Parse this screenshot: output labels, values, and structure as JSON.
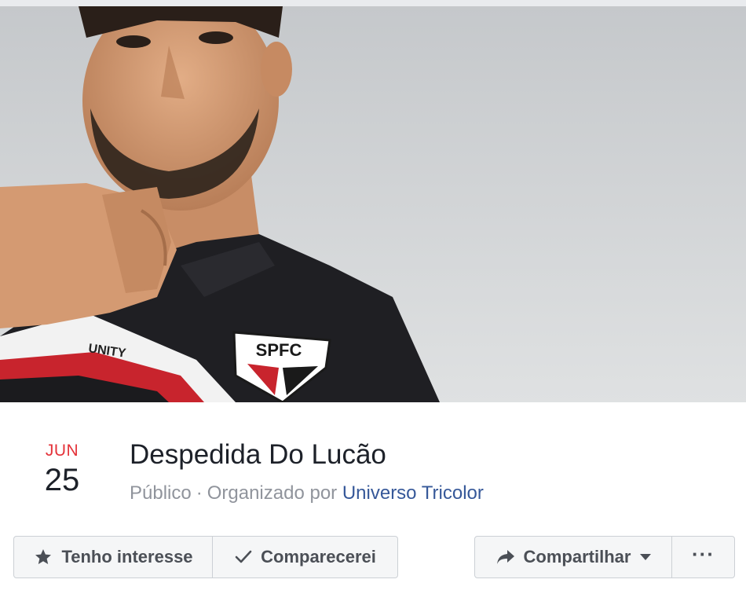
{
  "event": {
    "month": "JUN",
    "day": "25",
    "title": "Despedida Do Lucão",
    "privacy": "Público",
    "separator": "·",
    "organized_by_label": "Organizado por",
    "organizer": "Universo Tricolor"
  },
  "cover": {
    "shirt_badge_text": "SPFC",
    "shirt_brand_text": "UNITY"
  },
  "actions": {
    "interested_label": "Tenho interesse",
    "going_label": "Comparecerei",
    "share_label": "Compartilhar",
    "more_label": "···",
    "icons": {
      "interested": "star-icon",
      "going": "check-icon",
      "share": "share-arrow-icon",
      "share_dropdown": "caret-down-icon",
      "more": "more-icon"
    }
  },
  "colors": {
    "month": "#e4333a",
    "link": "#365899",
    "muted": "#90949c",
    "button_bg": "#f5f6f7",
    "button_border": "#ccd0d5"
  }
}
